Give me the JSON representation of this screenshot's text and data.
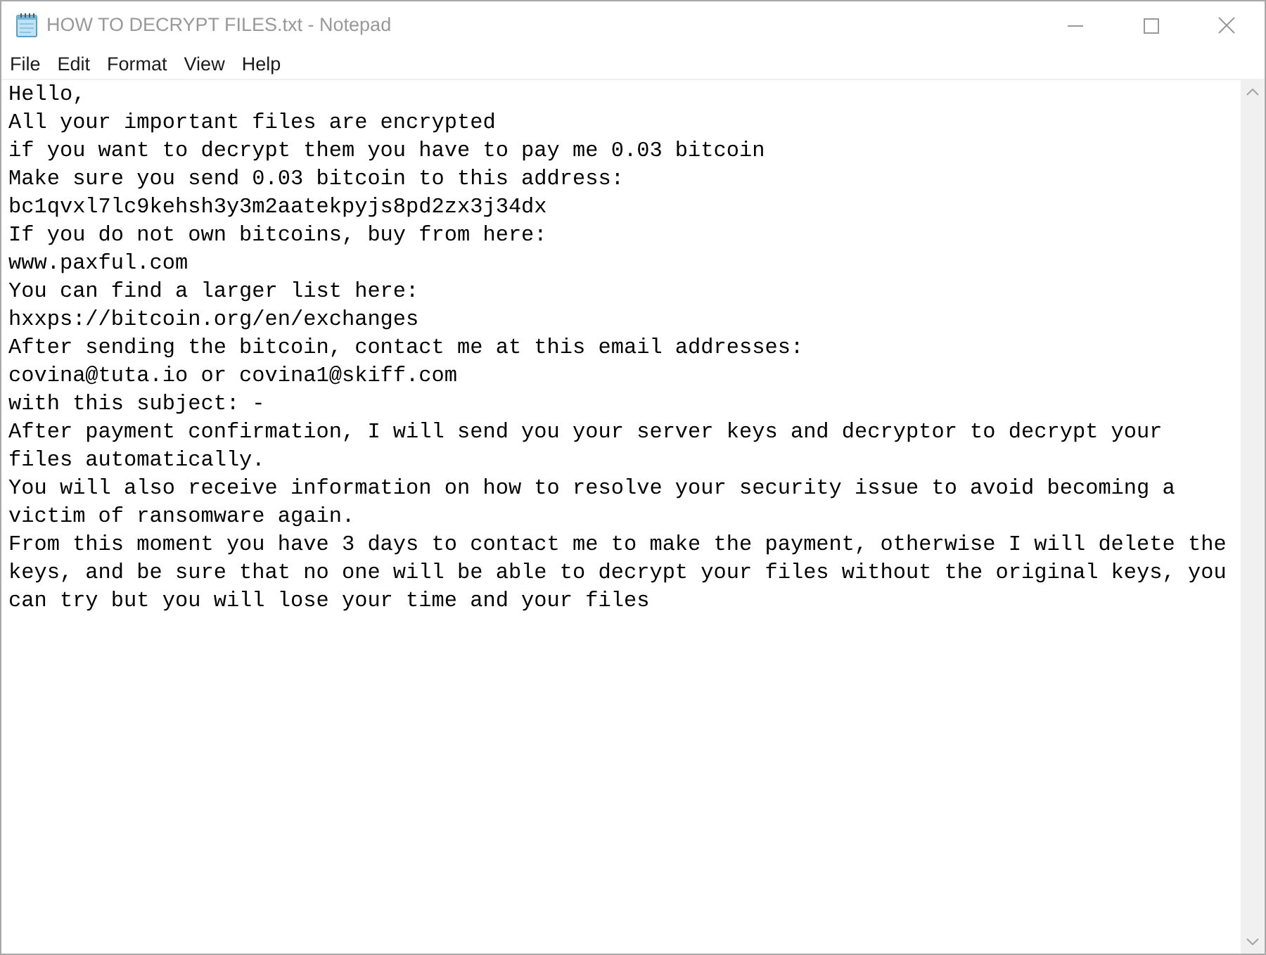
{
  "window": {
    "title": "HOW TO DECRYPT FILES.txt - Notepad",
    "focused": false
  },
  "menu_bar": [
    {
      "label": "File"
    },
    {
      "label": "Edit"
    },
    {
      "label": "Format"
    },
    {
      "label": "View"
    },
    {
      "label": "Help"
    }
  ],
  "document": {
    "lines": [
      "Hello,",
      "All your important files are encrypted",
      "if you want to decrypt them you have to pay me 0.03 bitcoin",
      "Make sure you send 0.03 bitcoin to this address:",
      "bc1qvxl7lc9kehsh3y3m2aatekpyjs8pd2zx3j34dx",
      "If you do not own bitcoins, buy from here:",
      "www.paxful.com",
      "You can find a larger list here:",
      "hxxps://bitcoin.org/en/exchanges",
      "After sending the bitcoin, contact me at this email addresses:",
      "covina@tuta.io or covina1@skiff.com",
      "with this subject: -",
      "After payment confirmation, I will send you your server keys and decryptor to decrypt your files automatically.",
      "You will also receive information on how to resolve your security issue to avoid becoming a victim of ransomware again.",
      "From this moment you have 3 days to contact me to make the payment, otherwise I will delete the keys, and be sure that no one will be able to decrypt your files without the original keys, you can try but you will lose your time and your files"
    ]
  }
}
